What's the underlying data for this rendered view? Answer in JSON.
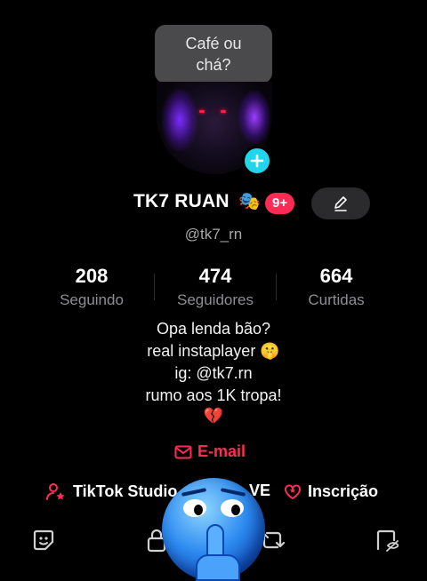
{
  "bubble": {
    "line1": "Café ou",
    "line2": "chá?"
  },
  "profile": {
    "name": "TK7 RUAN",
    "name_emoji": "🎭",
    "badge": "9+",
    "handle": "@tk7_rn"
  },
  "stats": [
    {
      "value": "208",
      "label": "Seguindo"
    },
    {
      "value": "474",
      "label": "Seguidores"
    },
    {
      "value": "664",
      "label": "Curtidas"
    }
  ],
  "bio": {
    "line1": "Opa lenda bão?",
    "line2": "real instaplayer 🤫",
    "line3": "ig: @tk7.rn",
    "line4": "rumo aos 1K tropa!",
    "line5": "💔"
  },
  "email_label": "E-mail",
  "links": {
    "studio": "TikTok Studio",
    "studio_suffix": "VE",
    "inscricao": "Inscrição"
  },
  "icons": {
    "plus": "plus-icon",
    "edit": "pencil-icon",
    "email": "envelope-icon",
    "studio": "person-star-icon",
    "inscricao": "heart-star-icon"
  },
  "colors": {
    "accent": "#fe2c55",
    "plus": "#20d5ec",
    "background": "#000000",
    "muted": "#8e8e93"
  }
}
